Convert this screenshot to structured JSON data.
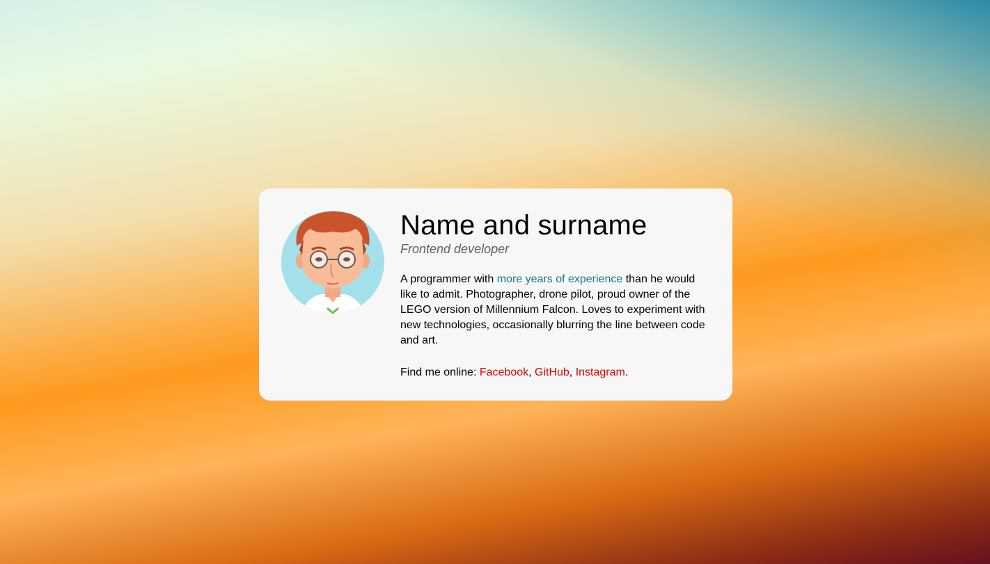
{
  "profile": {
    "name": "Name and surname",
    "role": "Frontend developer",
    "bio_before": "A programmer with ",
    "bio_link": "more years of experience",
    "bio_after": " than he would like to admit. Photographer, drone pilot, proud owner of the LEGO version of Millennium Falcon. Loves to experiment with new technologies, occasionally blurring the line between code and art.",
    "find_me_label": "Find me online: ",
    "links": [
      {
        "label": "Facebook"
      },
      {
        "label": "GitHub"
      },
      {
        "label": "Instagram"
      }
    ],
    "sep1": ", ",
    "sep2": ", ",
    "end": "."
  },
  "colors": {
    "card_bg": "#f7f7f7",
    "avatar_bg": "#a3e0ea",
    "inline_link": "#1b7487",
    "social_link": "#e00000"
  },
  "icons": {
    "avatar": "cartoon-man-with-glasses-avatar"
  }
}
